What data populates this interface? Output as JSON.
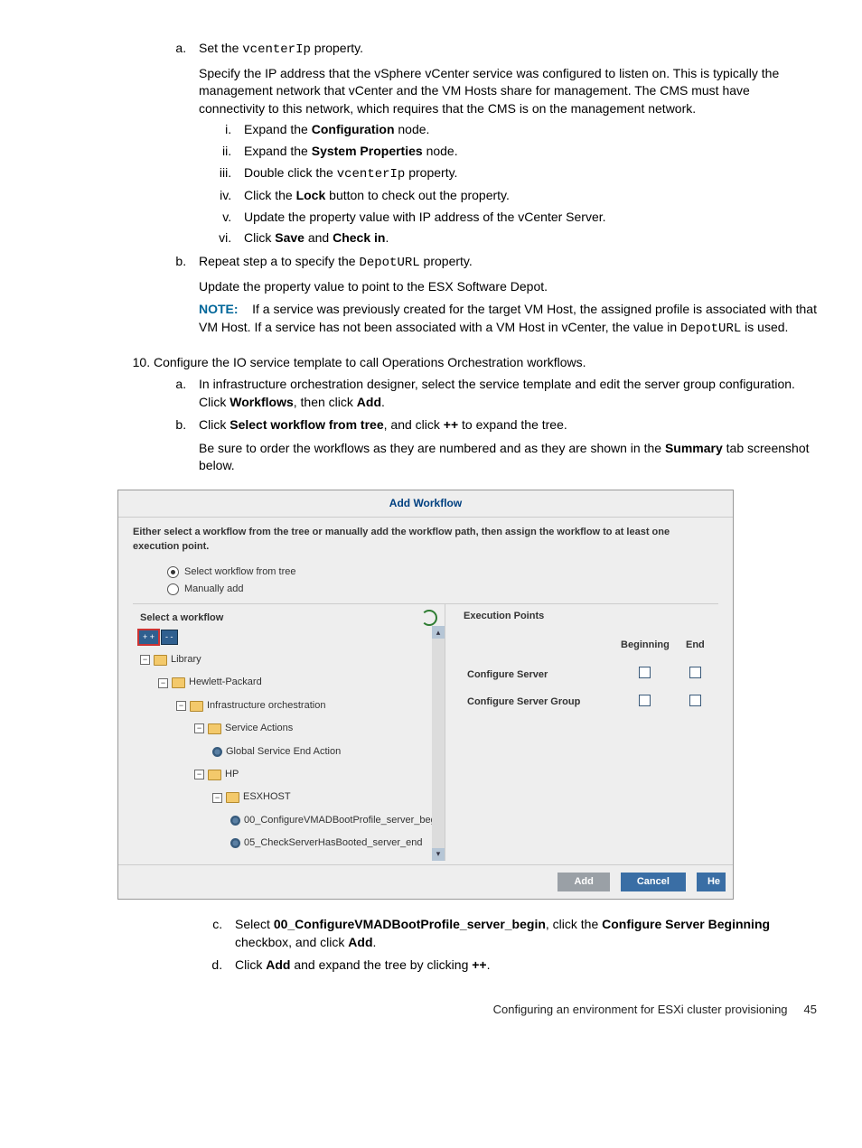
{
  "step9": {
    "a": {
      "lead_prefix": "Set the ",
      "lead_code": "vcenterIp",
      "lead_suffix": " property.",
      "desc": "Specify the IP address that the vSphere vCenter service was configured to listen on. This is typically the management network that vCenter and the VM Hosts share for management. The CMS must have connectivity to this network, which requires that the CMS is on the management network.",
      "i": {
        "pre": "Expand the ",
        "b": "Configuration",
        "post": " node."
      },
      "ii": {
        "pre": "Expand the ",
        "b": "System Properties",
        "post": " node."
      },
      "iii": {
        "pre": "Double click the ",
        "code": "vcenterIp",
        "post": " property."
      },
      "iv": {
        "pre": "Click the ",
        "b": "Lock",
        "post": " button to check out the property."
      },
      "v": "Update the property value with IP address of the vCenter Server.",
      "vi": {
        "pre": "Click ",
        "b1": "Save",
        "mid": " and ",
        "b2": "Check in",
        "post": "."
      }
    },
    "b": {
      "lead_prefix": "Repeat step a to specify the ",
      "lead_code": "DepotURL",
      "lead_suffix": " property.",
      "desc": "Update the property value to point to the ESX Software Depot.",
      "note_label": "NOTE:",
      "note_pre": "If a service was previously created for the target VM Host, the assigned profile is associated with that VM Host. If a service has not been associated with a VM Host in vCenter, the value in ",
      "note_code": "DepotURL",
      "note_post": " is used."
    }
  },
  "step10": {
    "lead": "Configure the IO service template to call Operations Orchestration workflows.",
    "a": {
      "pre": "In infrastructure orchestration designer, select the service template and edit the server group configuration. Click ",
      "b1": "Workflows",
      "mid": ", then click ",
      "b2": "Add",
      "post": "."
    },
    "b": {
      "pre": "Click ",
      "b1": "Select workflow from tree",
      "mid": ", and click ",
      "b2": "++",
      "post": " to expand the tree.",
      "desc_pre": "Be sure to order the workflows as they are numbered and as they are shown in the ",
      "desc_b": "Summary",
      "desc_post": " tab screenshot below."
    },
    "c": {
      "pre": "Select ",
      "b1": "00_ConfigureVMADBootProfile_server_begin",
      "mid": ", click the ",
      "b2": "Configure Server Beginning",
      "mid2": " checkbox, and click ",
      "b3": "Add",
      "post": "."
    },
    "d": {
      "pre": "Click ",
      "b1": "Add",
      "mid": " and expand the tree by clicking ",
      "b2": "++",
      "post": "."
    }
  },
  "dialog": {
    "title": "Add Workflow",
    "instructions": "Either select a workflow from the tree or manually add the workflow path, then assign the workflow to at least one execution point.",
    "radio1": "Select workflow from tree",
    "radio2": "Manually add",
    "left_header": "Select a workflow",
    "expand_btn": "+ +",
    "collapse_btn": "- -",
    "right_header": "Execution Points",
    "col_begin": "Beginning",
    "col_end": "End",
    "row1": "Configure Server",
    "row2": "Configure Server Group",
    "tree": {
      "library": "Library",
      "hp": "Hewlett-Packard",
      "io": "Infrastructure orchestration",
      "sa": "Service Actions",
      "gsea": "Global Service End Action",
      "hp2": "HP",
      "esxhost": "ESXHOST",
      "wf1": "00_ConfigureVMADBootProfile_server_beg",
      "wf2": "05_CheckServerHasBooted_server_end"
    },
    "btn_add": "Add",
    "btn_cancel": "Cancel",
    "btn_help": "He"
  },
  "footer": {
    "text": "Configuring an environment for ESXi cluster provisioning",
    "page": "45"
  }
}
